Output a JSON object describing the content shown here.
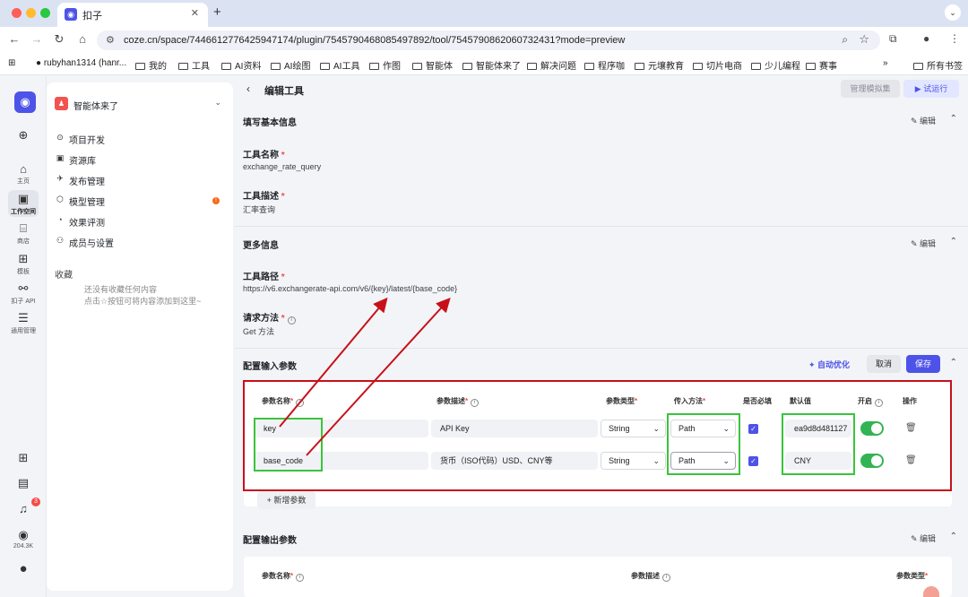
{
  "browser": {
    "tab_title": "扣子",
    "url": "coze.cn/space/7446612776425947174/plugin/7545790468085497892/tool/7545790862060732431?mode=preview",
    "bookmarks": [
      "rubyhan1314 (hanr...",
      "我的",
      "工具",
      "AI资料",
      "AI绘图",
      "AI工具",
      "作图",
      "智能体",
      "智能体来了",
      "解决问题",
      "程序咖",
      "元壤教育",
      "切片电商",
      "少儿编程",
      "赛事"
    ],
    "bookmarks_more": "»",
    "bookmarks_all": "所有书签"
  },
  "rail": {
    "home": "主页",
    "workspace": "工作空间",
    "store": "商店",
    "template": "模板",
    "api": "扣子 API",
    "admin": "通用管理",
    "bell_badge": "3",
    "points": "204.3K"
  },
  "space": {
    "name": "智能体来了",
    "menu": [
      "项目开发",
      "资源库",
      "发布管理",
      "模型管理",
      "效果评测",
      "成员与设置"
    ],
    "model_badge": "!",
    "favorites_title": "收藏",
    "favorites_empty_line1": "还没有收藏任何内容",
    "favorites_empty_line2": "点击☆按钮可将内容添加到这里~"
  },
  "header": {
    "title": "编辑工具",
    "mock_btn": "管理模拟集",
    "run_btn": "▶ 试运行"
  },
  "basic": {
    "section_title": "填写基本信息",
    "edit": "编辑",
    "name_label": "工具名称",
    "name_value": "exchange_rate_query",
    "desc_label": "工具描述",
    "desc_value": "汇率查询"
  },
  "more": {
    "section_title": "更多信息",
    "edit": "编辑",
    "path_label": "工具路径",
    "path_value": "https://v6.exchangerate-api.com/v6/{key}/latest/{base_code}",
    "method_label": "请求方法",
    "method_value": "Get 方法"
  },
  "input_params": {
    "section_title": "配置输入参数",
    "auto_optimize": "自动优化",
    "cancel": "取消",
    "save": "保存",
    "columns": [
      "参数名称",
      "参数描述",
      "参数类型",
      "传入方法",
      "是否必填",
      "默认值",
      "开启",
      "操作"
    ],
    "rows": [
      {
        "name": "key",
        "desc": "API Key",
        "type": "String",
        "method": "Path",
        "required": true,
        "default": "ea9d8d481127",
        "enabled": true
      },
      {
        "name": "base_code",
        "desc": "货币（ISO代码）USD、CNY等",
        "type": "String",
        "method": "Path",
        "required": true,
        "default": "CNY",
        "enabled": true
      }
    ],
    "add_param": "+ 新增参数"
  },
  "output_params": {
    "section_title": "配置输出参数",
    "edit": "编辑",
    "columns": [
      "参数名称",
      "参数描述",
      "参数类型"
    ]
  },
  "colors": {
    "accent": "#4d53e8",
    "annotation_red": "#c8101a",
    "annotation_green": "#3ac43a",
    "toggle_on": "#32b454"
  }
}
